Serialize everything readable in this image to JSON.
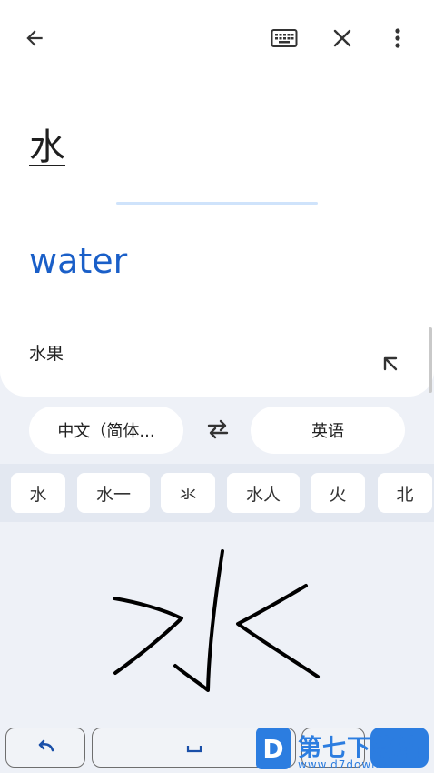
{
  "source": {
    "text": "水"
  },
  "translation": {
    "text": "water"
  },
  "suggestion": {
    "text": "水果"
  },
  "languages": {
    "source": "中文（简体...",
    "target": "英语"
  },
  "candidates": [
    "水",
    "水一",
    "氺",
    "水人",
    "火",
    "北"
  ],
  "icons": {
    "back": "arrow-left-icon",
    "keyboard": "keyboard-icon",
    "close": "close-icon",
    "more": "more-vert-icon",
    "expand": "arrow-up-left-icon",
    "swap": "swap-icon",
    "undo": "undo-icon",
    "space": "space-icon"
  },
  "colors": {
    "accent": "#1a5fc8",
    "background": "#eef1f7"
  },
  "watermark": {
    "logo": "D",
    "title": "第七下载站",
    "url": "www.d7down.com"
  }
}
